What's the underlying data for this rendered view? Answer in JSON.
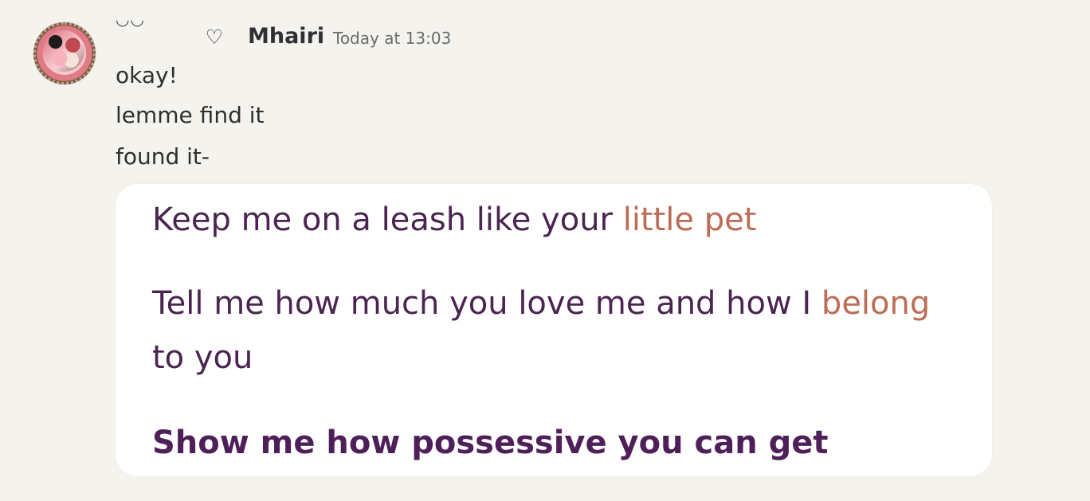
{
  "message": {
    "author": "Mhairi",
    "timestamp": "Today at 13:03",
    "decor": {
      "kaomoji": "◡◡",
      "heart": "♡"
    },
    "lines": [
      "okay!",
      "lemme find it",
      "found it-"
    ]
  },
  "image": {
    "lines": [
      {
        "before": "Keep me on a leash like your ",
        "highlight": "little pet",
        "after": ""
      },
      {
        "before": "Tell me how much you love me and how I ",
        "highlight": "belong",
        "after": ""
      },
      {
        "before": "to you",
        "highlight": "",
        "after": ""
      },
      {
        "before": "Show me how possessive you can get",
        "highlight": "",
        "after": ""
      }
    ],
    "colors": {
      "text": "#4b2451",
      "highlight": "#bd6c55"
    }
  },
  "icons": {
    "avatar": "avatar-icon",
    "heart": "heart-icon"
  }
}
